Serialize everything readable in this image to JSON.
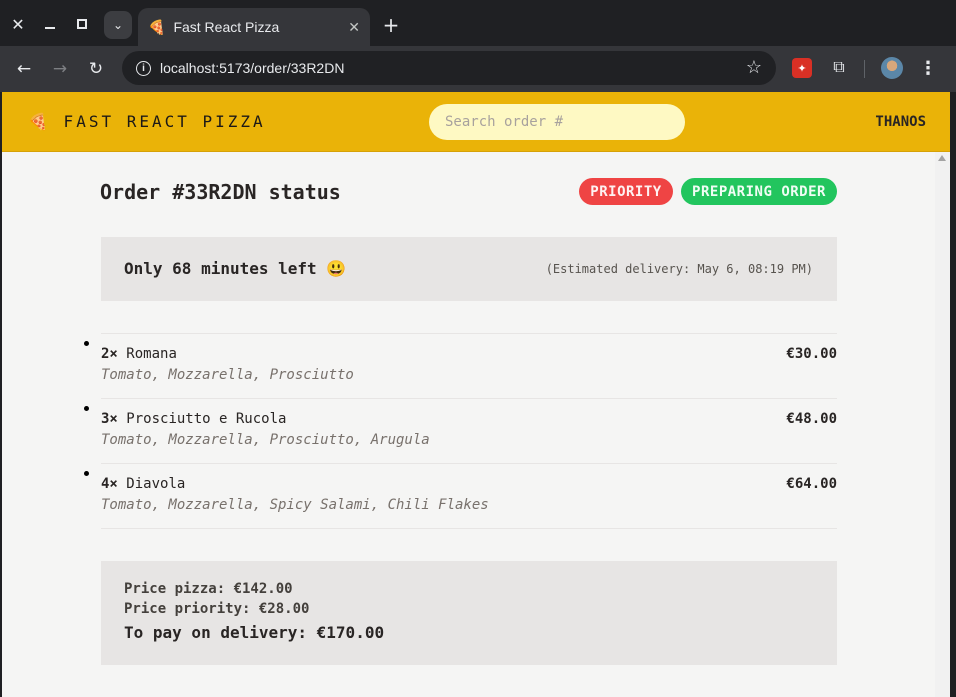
{
  "browser": {
    "tab_title": "Fast React Pizza",
    "tab_favicon": "🍕",
    "url": "localhost:5173/order/33R2DN"
  },
  "header": {
    "logo": "🍕 Fast React Pizza",
    "search_placeholder": "Search order #",
    "username": "thanos",
    "accent_color": "#eab308"
  },
  "order": {
    "title": "Order #33R2DN status",
    "badges": {
      "priority": "Priority",
      "status": "Preparing order"
    },
    "eta_main": "Only 68 minutes left 😃",
    "eta_sub": "(Estimated delivery: May 6, 08:19 PM)",
    "items": [
      {
        "qty": "2×",
        "name": "Romana",
        "ingredients": "Tomato, Mozzarella, Prosciutto",
        "price": "€30.00"
      },
      {
        "qty": "3×",
        "name": "Prosciutto e Rucola",
        "ingredients": "Tomato, Mozzarella, Prosciutto, Arugula",
        "price": "€48.00"
      },
      {
        "qty": "4×",
        "name": "Diavola",
        "ingredients": "Tomato, Mozzarella, Spicy Salami, Chili Flakes",
        "price": "€64.00"
      }
    ],
    "summary": {
      "price_pizza": "Price pizza: €142.00",
      "price_priority": "Price priority: €28.00",
      "to_pay": "To pay on delivery: €170.00"
    }
  }
}
